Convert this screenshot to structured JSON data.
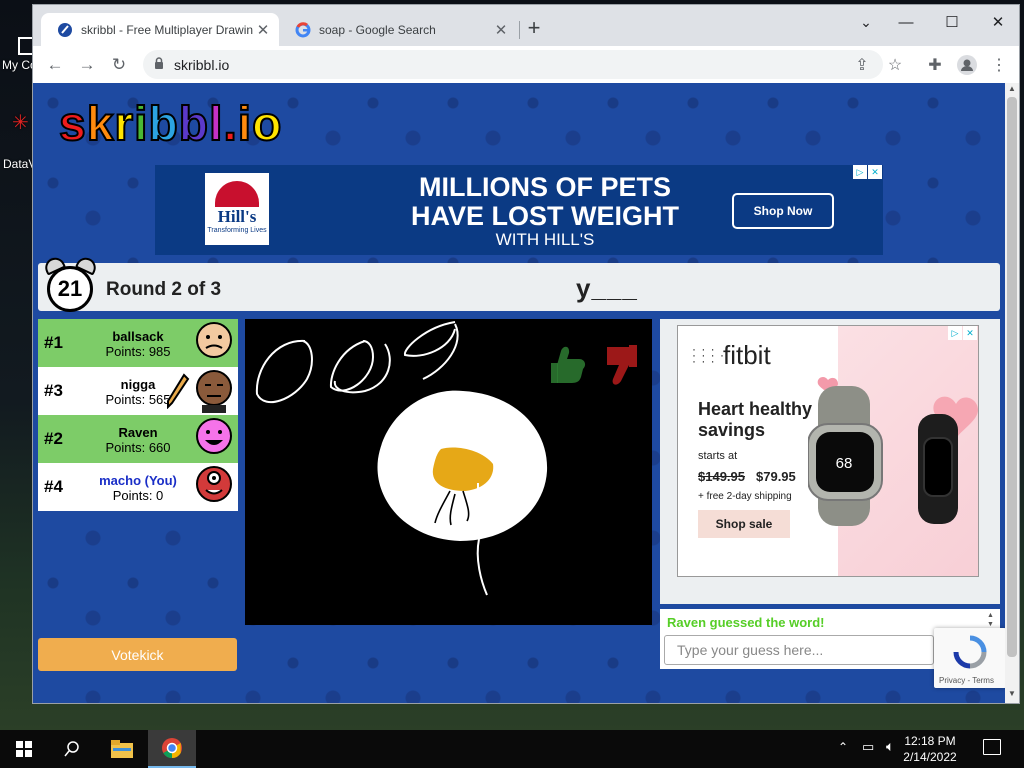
{
  "desktop": {
    "icons": [
      {
        "label": "My Co"
      },
      {
        "label": "DataV"
      }
    ]
  },
  "browser": {
    "tabs": [
      {
        "title": "skribbl - Free Multiplayer Drawing",
        "favicon": "skribbl-icon",
        "active": true
      },
      {
        "title": "soap - Google Search",
        "favicon": "google-icon",
        "active": false
      }
    ],
    "new_tab": "+",
    "url": "skribbl.io",
    "window_controls": {
      "minimize": "—",
      "maximize": "☐",
      "close": "✕"
    }
  },
  "page": {
    "logo": "skribbl.io",
    "ad_top": {
      "brand": "Hill's",
      "tagline": "Transforming Lives",
      "headline_line1": "MILLIONS OF PETS",
      "headline_line2": "HAVE LOST WEIGHT",
      "subline": "WITH HILL'S",
      "cta": "Shop Now"
    },
    "header": {
      "timer": "21",
      "round": "Round 2 of 3",
      "word_hint": "y___"
    },
    "players": [
      {
        "rank": "#1",
        "name": "ballsack",
        "points": "Points: 985",
        "bg": "#7dcc68",
        "name_color": "#000000",
        "avatar_color": "#f2c9a0",
        "drawing": false
      },
      {
        "rank": "#3",
        "name": "nigga",
        "points": "Points: 565",
        "bg": "#ffffff",
        "name_color": "#000000",
        "avatar_color": "#8a5a3b",
        "drawing": true
      },
      {
        "rank": "#2",
        "name": "Raven",
        "points": "Points: 660",
        "bg": "#7dcc68",
        "name_color": "#000000",
        "avatar_color": "#f573e9",
        "drawing": false
      },
      {
        "rank": "#4",
        "name": "macho (You)",
        "points": "Points: 0",
        "bg": "#ffffff",
        "name_color": "#1a2ec7",
        "avatar_color": "#d23a3a",
        "drawing": false
      }
    ],
    "ad_right": {
      "brand": "fitbit",
      "headline": "Heart healthy savings",
      "starts_at": "starts at",
      "old_price": "$149.95",
      "new_price": "$79.95",
      "shipping": "+ free 2-day shipping",
      "cta": "Shop sale",
      "watch_display": "68"
    },
    "chat": {
      "messages": [
        {
          "text": "Raven guessed the word!",
          "color": "#56ce27"
        }
      ]
    },
    "guess_placeholder": "Type your guess here...",
    "votekick": "Votekick",
    "recaptcha": "Privacy - Terms",
    "accent": "#f0ad4e"
  },
  "taskbar": {
    "time": "12:18 PM",
    "date": "2/14/2022"
  }
}
